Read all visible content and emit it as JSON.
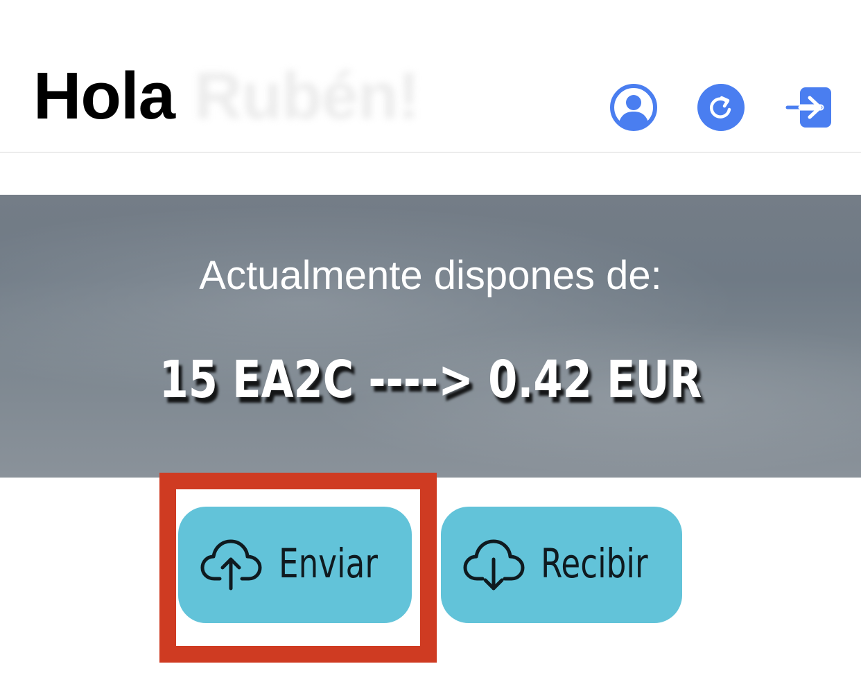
{
  "header": {
    "greeting": "Hola",
    "user_name": "Rubén!",
    "icons": [
      "user-circle-icon",
      "refresh-icon",
      "sign-in-icon"
    ]
  },
  "balance": {
    "caption": "Actualmente dispones de:",
    "value": "15 EA2C ----> 0.42 EUR"
  },
  "actions": {
    "send_label": "Enviar",
    "send_icon": "cloud-upload-icon",
    "receive_label": "Recibir",
    "receive_icon": "cloud-download-icon"
  },
  "colors": {
    "accent_blue": "#4a7ef0",
    "button_bg": "#62c3d9",
    "highlight": "#cf3b22",
    "banner": "#747d87"
  }
}
